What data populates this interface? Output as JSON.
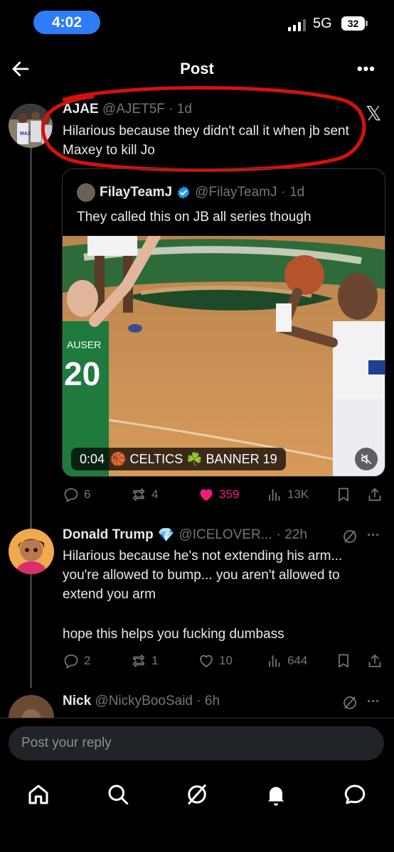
{
  "status_bar": {
    "time": "4:02",
    "network": "5G",
    "battery": "32"
  },
  "header": {
    "title": "Post"
  },
  "main_post": {
    "name": "AJAE",
    "handle": "@AJET5F",
    "time": "· 1d",
    "text": "Hilarious because they didn't call it when jb sent Maxey to kill Jo",
    "quote": {
      "name": "FilayTeamJ",
      "handle": "@FilayTeamJ",
      "time": "· 1d",
      "text": "They called this on JB all series though",
      "video": {
        "timestamp": "0:04",
        "caption": "🏀 CELTICS ☘️ BANNER 19"
      }
    },
    "actions": {
      "replies": "6",
      "reposts": "4",
      "likes": "359",
      "views": "13K"
    }
  },
  "reply_1": {
    "name": "Donald Trump",
    "badge": "💎",
    "handle": "@ICELOVER...",
    "time": "· 22h",
    "text": "Hilarious because he's not extending his arm... you're allowed to bump... you aren't allowed to extend you arm",
    "text2": "hope this helps you fucking dumbass",
    "actions": {
      "replies": "2",
      "reposts": "1",
      "likes": "10",
      "views": "644"
    }
  },
  "reply_2": {
    "name": "Nick",
    "handle": "@NickyBooSaid",
    "time": "· 6h"
  },
  "composer": {
    "placeholder": "Post your reply"
  },
  "colors": {
    "accent": "#1d9bf0",
    "like": "#f91880",
    "annotation": "#d4120c",
    "time_pill": "#2f7df6"
  },
  "icons": [
    "back-arrow-icon",
    "more-icon",
    "x-logo-icon",
    "verified-icon",
    "reply-icon",
    "repost-icon",
    "like-icon",
    "views-icon",
    "bookmark-icon",
    "share-icon",
    "grok-icon",
    "home-icon",
    "search-icon",
    "bell-icon",
    "messages-icon",
    "mute-icon"
  ]
}
